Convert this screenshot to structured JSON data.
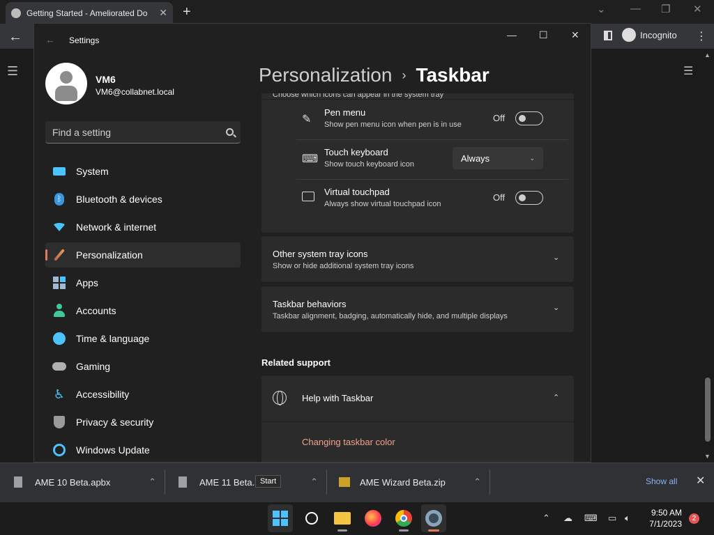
{
  "browser": {
    "tab_title": "Getting Started - Ameliorated Do",
    "new_tab": "+",
    "incognito_label": "Incognito"
  },
  "downloads": {
    "items": [
      {
        "name": "AME 10 Beta.apbx"
      },
      {
        "name": "AME 11 Beta.a"
      },
      {
        "name": "AME Wizard Beta.zip"
      }
    ],
    "show_all": "Show all",
    "tooltip": "Start"
  },
  "settings": {
    "window_title": "Settings",
    "profile": {
      "name": "VM6",
      "email": "VM6@collabnet.local"
    },
    "search_placeholder": "Find a setting",
    "nav": [
      {
        "label": "System",
        "icon": "system-icon",
        "color": "#4cc2ff"
      },
      {
        "label": "Bluetooth & devices",
        "icon": "bluetooth-icon",
        "color": "#3a96dd"
      },
      {
        "label": "Network & internet",
        "icon": "wifi-icon",
        "color": "#4cc2ff"
      },
      {
        "label": "Personalization",
        "icon": "brush-icon",
        "color": "#e0a060"
      },
      {
        "label": "Apps",
        "icon": "apps-icon",
        "color": "#a0b8d0"
      },
      {
        "label": "Accounts",
        "icon": "accounts-icon",
        "color": "#3fc99a"
      },
      {
        "label": "Time & language",
        "icon": "globe-clock-icon",
        "color": "#4cc2ff"
      },
      {
        "label": "Gaming",
        "icon": "gamepad-icon",
        "color": "#b0b0b0"
      },
      {
        "label": "Accessibility",
        "icon": "accessibility-icon",
        "color": "#4cc2ff"
      },
      {
        "label": "Privacy & security",
        "icon": "shield-icon",
        "color": "#9a9a9a"
      },
      {
        "label": "Windows Update",
        "icon": "update-icon",
        "color": "#4cc2ff"
      }
    ],
    "selected_index": 3,
    "breadcrumb": {
      "parent": "Personalization",
      "separator": "›",
      "current": "Taskbar"
    },
    "tray_subtitle": "Choose which icons can appear in the system tray",
    "rows": [
      {
        "title": "Pen menu",
        "subtitle": "Show pen menu icon when pen is in use",
        "control": "toggle",
        "state": "Off"
      },
      {
        "title": "Touch keyboard",
        "subtitle": "Show touch keyboard icon",
        "control": "select",
        "value": "Always"
      },
      {
        "title": "Virtual touchpad",
        "subtitle": "Always show virtual touchpad icon",
        "control": "toggle",
        "state": "Off"
      }
    ],
    "other_tray": {
      "title": "Other system tray icons",
      "subtitle": "Show or hide additional system tray icons"
    },
    "behaviors": {
      "title": "Taskbar behaviors",
      "subtitle": "Taskbar alignment, badging, automatically hide, and multiple displays"
    },
    "related_support": "Related support",
    "help": {
      "title": "Help with Taskbar",
      "link": "Changing taskbar color"
    }
  },
  "taskbar": {
    "time": "9:50 AM",
    "date": "7/1/2023",
    "badge": "2"
  }
}
